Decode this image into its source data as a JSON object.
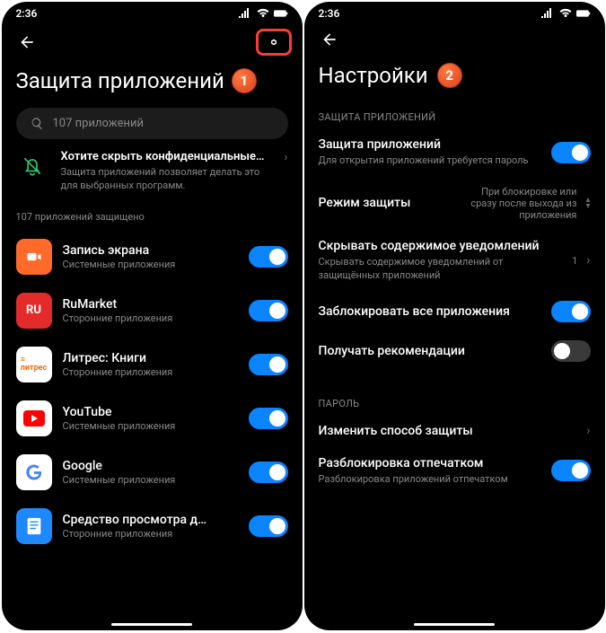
{
  "time": "2:36",
  "left": {
    "title": "Защита приложений",
    "badge": "1",
    "search_placeholder": "107 приложений",
    "promo": {
      "title": "Хотите скрыть конфиденциальные…",
      "sub": "Защита приложений позволяет делать это для выбранных программ."
    },
    "count_label": "107 приложений защищено",
    "apps": [
      {
        "name": "Запись экрана",
        "sub": "Системные приложения",
        "color": "#ff6a2b",
        "on": true
      },
      {
        "name": "RuMarket",
        "sub": "Сторонние приложения",
        "color": "#e52a2a",
        "glyph": "RU",
        "on": true
      },
      {
        "name": "Литрес: Книги",
        "sub": "Сторонние приложения",
        "color": "#ffffff",
        "glyph": "≡",
        "on": true
      },
      {
        "name": "YouTube",
        "sub": "Системные приложения",
        "color": "#ffffff",
        "on": true
      },
      {
        "name": "Google",
        "sub": "Системные приложения",
        "color": "#ffffff",
        "glyph": "G",
        "on": true
      },
      {
        "name": "Средство просмотра д…",
        "sub": "Сторонние приложения",
        "color": "#1e88ff",
        "on": true
      }
    ]
  },
  "right": {
    "title": "Настройки",
    "badge": "2",
    "section1": "ЗАЩИТА ПРИЛОЖЕНИЙ",
    "rows": [
      {
        "title": "Защита приложений",
        "sub": "Для открытия приложений требуется пароль",
        "toggle": true
      },
      {
        "title": "Режим защиты",
        "value": "При блокировке или сразу после выхода из приложения",
        "arrow": "updown"
      },
      {
        "title": "Скрывать содержимое уведомлений",
        "sub": "Скрывать содержимое уведомлений от защищённых приложений",
        "value": "1",
        "arrow": "chev"
      },
      {
        "title": "Заблокировать все приложения",
        "toggle": true
      },
      {
        "title": "Получать рекомендации",
        "toggle": false
      }
    ],
    "section2": "ПАРОЛЬ",
    "rows2": [
      {
        "title": "Изменить способ защиты",
        "arrow": "chev"
      },
      {
        "title": "Разблокировка отпечатком",
        "sub": "Разблокировка приложений отпечатком",
        "toggle": true
      }
    ]
  }
}
